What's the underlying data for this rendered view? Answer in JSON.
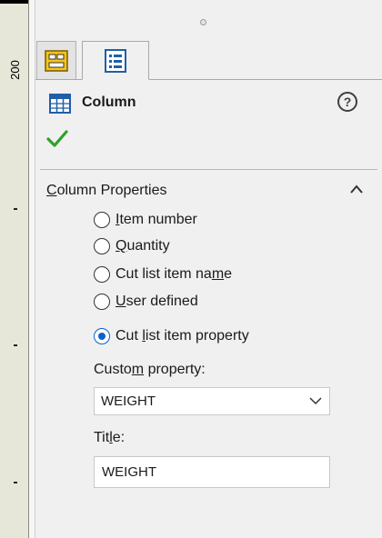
{
  "ruler": {
    "label": "200"
  },
  "tabs": [
    {
      "icon": "feature-manager-icon",
      "active": false
    },
    {
      "icon": "property-manager-icon",
      "active": true
    }
  ],
  "header": {
    "title": "Column",
    "icon": "table-column-icon",
    "help_icon": "help-icon"
  },
  "confirm_icon": "checkmark-icon",
  "section": {
    "title_prefix": "C",
    "title_rest": "olumn Properties",
    "collapsed": false
  },
  "options": [
    {
      "pre": "",
      "ul": "I",
      "post": "tem number",
      "checked": false
    },
    {
      "pre": "",
      "ul": "Q",
      "post": "uantity",
      "checked": false
    },
    {
      "pre": "Cut list item na",
      "ul": "m",
      "post": "e",
      "checked": false
    },
    {
      "pre": "",
      "ul": "U",
      "post": "ser defined",
      "checked": false
    },
    {
      "pre": "Cut ",
      "ul": "l",
      "post": "ist item property",
      "checked": true
    }
  ],
  "custom_property": {
    "label_pre": "Custo",
    "label_ul": "m",
    "label_post": " property:",
    "value": "WEIGHT"
  },
  "title_field": {
    "label_pre": "Tit",
    "label_ul": "l",
    "label_post": "e:",
    "value": "WEIGHT"
  },
  "colors": {
    "accent": "#0b63c9",
    "check": "#2ea02e"
  }
}
